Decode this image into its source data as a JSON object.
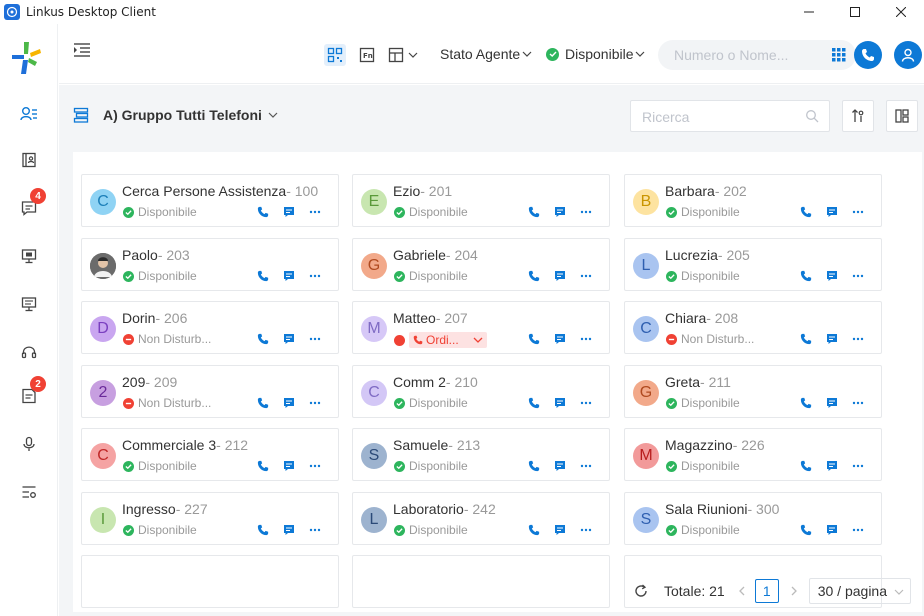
{
  "window": {
    "title": "Linkus Desktop Client"
  },
  "sidebar": {
    "chat_badge": "4",
    "voicemail_badge": "2"
  },
  "topbar": {
    "agent_status_label": "Stato Agente",
    "presence_label": "Disponibile",
    "dial_placeholder": "Numero o Nome..."
  },
  "group": {
    "title": "A) Gruppo Tutti Telefoni",
    "search_placeholder": "Ricerca"
  },
  "colors": {
    "accent": "#0d79d6",
    "available": "#2db55d",
    "dnd": "#f04134"
  },
  "contacts": [
    {
      "initial": "C",
      "name": "Cerca Persone Assistenza",
      "ext": "- 100",
      "status": "Disponibile",
      "state": "ok",
      "avatar_color": "#8fd3f4",
      "text_color": "#1c7fb8"
    },
    {
      "initial": "E",
      "name": "Ezio",
      "ext": "- 201",
      "status": "Disponibile",
      "state": "ok",
      "avatar_color": "#c8e6b0",
      "text_color": "#5a9a3a"
    },
    {
      "initial": "B",
      "name": "Barbara",
      "ext": "- 202",
      "status": "Disponibile",
      "state": "ok",
      "avatar_color": "#fde3a0",
      "text_color": "#c99500"
    },
    {
      "initial": "",
      "name": "Paolo",
      "ext": "- 203",
      "status": "Disponibile",
      "state": "ok",
      "avatar_color": "#555555",
      "text_color": "#ffffff",
      "photo": true
    },
    {
      "initial": "G",
      "name": "Gabriele",
      "ext": "- 204",
      "status": "Disponibile",
      "state": "ok",
      "avatar_color": "#f2a98a",
      "text_color": "#b04a20"
    },
    {
      "initial": "L",
      "name": "Lucrezia",
      "ext": "- 205",
      "status": "Disponibile",
      "state": "ok",
      "avatar_color": "#a9c4f0",
      "text_color": "#2f5fb0"
    },
    {
      "initial": "D",
      "name": "Dorin",
      "ext": "- 206",
      "status": "Non Disturb...",
      "state": "dnd",
      "avatar_color": "#c9a6f0",
      "text_color": "#7a3fc0"
    },
    {
      "initial": "M",
      "name": "Matteo",
      "ext": "- 207",
      "status": "Ordi...",
      "state": "call",
      "avatar_color": "#d6c8f7",
      "text_color": "#7f6bc4"
    },
    {
      "initial": "C",
      "name": "Chiara",
      "ext": "- 208",
      "status": "Non Disturb...",
      "state": "dnd",
      "avatar_color": "#a9c4f0",
      "text_color": "#2f5fb0"
    },
    {
      "initial": "2",
      "name": "209",
      "ext": "- 209",
      "status": "Non Disturb...",
      "state": "dnd",
      "avatar_color": "#c79fe0",
      "text_color": "#6a2a9a"
    },
    {
      "initial": "C",
      "name": "Comm 2",
      "ext": "- 210",
      "status": "Disponibile",
      "state": "ok",
      "avatar_color": "#d3c7f6",
      "text_color": "#7f6bc4"
    },
    {
      "initial": "G",
      "name": "Greta",
      "ext": "- 211",
      "status": "Disponibile",
      "state": "ok",
      "avatar_color": "#f2a98a",
      "text_color": "#b04a20"
    },
    {
      "initial": "C",
      "name": "Commerciale 3",
      "ext": "- 212",
      "status": "Disponibile",
      "state": "ok",
      "avatar_color": "#f5a3a3",
      "text_color": "#c02828"
    },
    {
      "initial": "S",
      "name": "Samuele",
      "ext": "- 213",
      "status": "Disponibile",
      "state": "ok",
      "avatar_color": "#9db3cf",
      "text_color": "#2b4a78"
    },
    {
      "initial": "M",
      "name": "Magazzino",
      "ext": "- 226",
      "status": "Disponibile",
      "state": "ok",
      "avatar_color": "#f29a9a",
      "text_color": "#b81e1e"
    },
    {
      "initial": "I",
      "name": "Ingresso",
      "ext": "- 227",
      "status": "Disponibile",
      "state": "ok",
      "avatar_color": "#c8e6b0",
      "text_color": "#5a9a3a"
    },
    {
      "initial": "L",
      "name": "Laboratorio",
      "ext": "- 242",
      "status": "Disponibile",
      "state": "ok",
      "avatar_color": "#9db3cf",
      "text_color": "#2b4a78"
    },
    {
      "initial": "S",
      "name": "Sala Riunioni",
      "ext": "- 300",
      "status": "Disponibile",
      "state": "ok",
      "avatar_color": "#a9c4f0",
      "text_color": "#2f5fb0"
    }
  ],
  "pagination": {
    "total_label": "Totale: 21",
    "current_page": "1",
    "page_size": "30 / pagina"
  }
}
